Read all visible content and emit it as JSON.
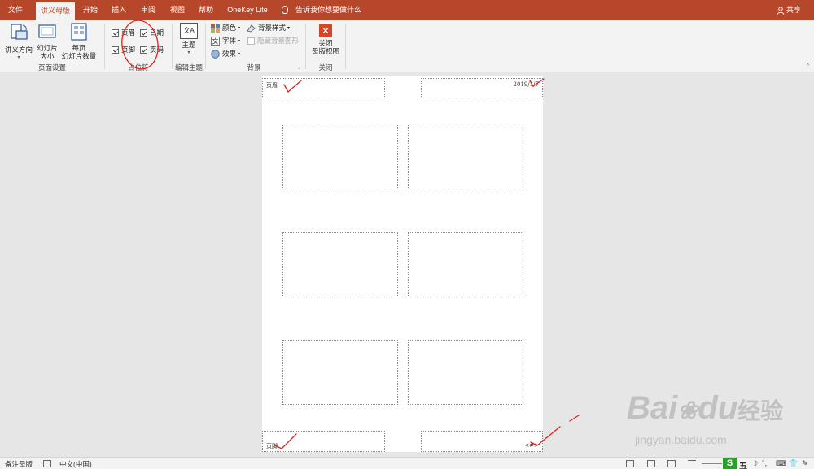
{
  "tabs": [
    {
      "label": "文件",
      "active": false
    },
    {
      "label": "讲义母版",
      "active": true
    },
    {
      "label": "开始",
      "active": false
    },
    {
      "label": "插入",
      "active": false
    },
    {
      "label": "审阅",
      "active": false
    },
    {
      "label": "视图",
      "active": false
    },
    {
      "label": "帮助",
      "active": false
    },
    {
      "label": "OneKey Lite",
      "active": false
    }
  ],
  "tell_me": "告诉我你想要做什么",
  "share": "共享",
  "ribbon": {
    "page_setup": {
      "orientation_label": "讲义方向",
      "slide_size_line1": "幻灯片",
      "slide_size_line2": "大小",
      "per_page_line1": "每页",
      "per_page_line2": "幻灯片数量",
      "group_label": "页面设置"
    },
    "placeholders": {
      "header": "页眉",
      "date": "日期",
      "footer": "页脚",
      "page_number": "页码",
      "group_label": "占位符"
    },
    "edit_theme": {
      "theme_label": "主题",
      "theme_icon_text": "文A",
      "group_label": "编辑主题"
    },
    "background": {
      "colors": "颜色",
      "background_styles": "背景样式",
      "fonts": "字体",
      "hide_background": "隐藏背景图形",
      "effects": "效果",
      "group_label": "背景"
    },
    "close": {
      "line1": "关闭",
      "line2": "母版视图",
      "group_label": "关闭"
    }
  },
  "page": {
    "header_text": "页眉",
    "date_text": "2019/1/7",
    "footer_text": "页脚",
    "page_number_text": "<#>"
  },
  "status": {
    "notes_master": "备注母版",
    "language": "中文(中国)"
  },
  "watermark": {
    "brand": "Bai",
    "brand_cn": "经验",
    "url": "jingyan.baidu.com"
  },
  "colors": {
    "accent": "#b7472a",
    "ink": "#e0201b"
  }
}
